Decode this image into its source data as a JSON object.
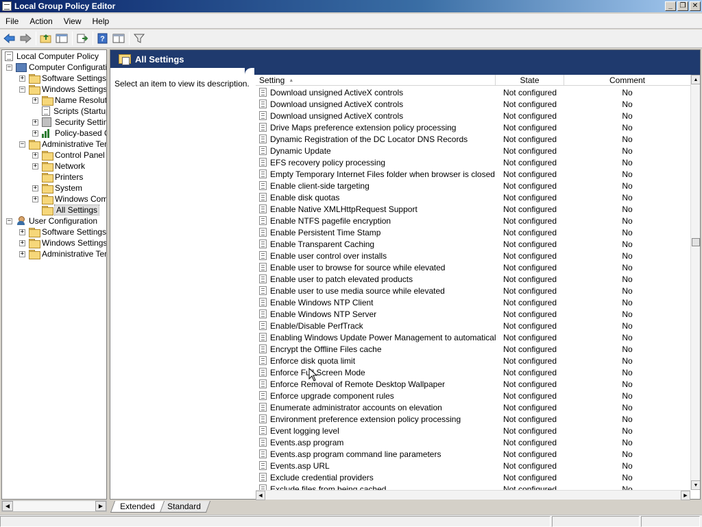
{
  "window": {
    "title": "Local Group Policy Editor",
    "minimize": "_",
    "maximize": "❐",
    "close": "✕"
  },
  "menu": [
    "File",
    "Action",
    "View",
    "Help"
  ],
  "toolbar": {
    "buttons": [
      "back-arrow-icon",
      "forward-arrow-icon",
      "up-folder-icon",
      "show-hide-tree-icon",
      "export-list-icon",
      "help-icon",
      "properties-icon",
      "filter-icon"
    ]
  },
  "tree": {
    "root": "Local Computer Policy",
    "computer_configuration": "Computer Configuration",
    "software_settings": "Software Settings",
    "windows_settings": "Windows Settings",
    "name_resolution": "Name Resolutio",
    "scripts": "Scripts (Startup",
    "security_settings": "Security Setting",
    "policy_based_qos": "Policy-based Q",
    "administrative_templates": "Administrative Temp",
    "control_panel": "Control Panel",
    "network": "Network",
    "printers": "Printers",
    "system": "System",
    "windows_components": "Windows Comp",
    "all_settings": "All Settings",
    "user_configuration": "User Configuration",
    "user_software_settings": "Software Settings",
    "user_windows_settings": "Windows Settings",
    "user_administrative_templates": "Administrative Temp"
  },
  "right": {
    "banner_title": "All Settings",
    "description": "Select an item to view its description."
  },
  "grid": {
    "columns": [
      "Setting",
      "State",
      "Comment"
    ],
    "rows": [
      [
        "Download unsigned ActiveX controls",
        "Not configured",
        "No"
      ],
      [
        "Download unsigned ActiveX controls",
        "Not configured",
        "No"
      ],
      [
        "Download unsigned ActiveX controls",
        "Not configured",
        "No"
      ],
      [
        "Drive Maps preference extension policy processing",
        "Not configured",
        "No"
      ],
      [
        "Dynamic Registration of the DC Locator DNS Records",
        "Not configured",
        "No"
      ],
      [
        "Dynamic Update",
        "Not configured",
        "No"
      ],
      [
        "EFS recovery policy processing",
        "Not configured",
        "No"
      ],
      [
        "Empty Temporary Internet Files folder when browser is closed",
        "Not configured",
        "No"
      ],
      [
        "Enable client-side targeting",
        "Not configured",
        "No"
      ],
      [
        "Enable disk quotas",
        "Not configured",
        "No"
      ],
      [
        "Enable Native XMLHttpRequest Support",
        "Not configured",
        "No"
      ],
      [
        "Enable NTFS pagefile encryption",
        "Not configured",
        "No"
      ],
      [
        "Enable Persistent Time Stamp",
        "Not configured",
        "No"
      ],
      [
        "Enable Transparent Caching",
        "Not configured",
        "No"
      ],
      [
        "Enable user control over installs",
        "Not configured",
        "No"
      ],
      [
        "Enable user to browse for source while elevated",
        "Not configured",
        "No"
      ],
      [
        "Enable user to patch elevated products",
        "Not configured",
        "No"
      ],
      [
        "Enable user to use media source while elevated",
        "Not configured",
        "No"
      ],
      [
        "Enable Windows NTP Client",
        "Not configured",
        "No"
      ],
      [
        "Enable Windows NTP Server",
        "Not configured",
        "No"
      ],
      [
        "Enable/Disable PerfTrack",
        "Not configured",
        "No"
      ],
      [
        "Enabling Windows Update Power Management to automatically wa...",
        "Not configured",
        "No"
      ],
      [
        "Encrypt the Offline Files cache",
        "Not configured",
        "No"
      ],
      [
        "Enforce disk quota limit",
        "Not configured",
        "No"
      ],
      [
        "Enforce Full Screen Mode",
        "Not configured",
        "No"
      ],
      [
        "Enforce Removal of Remote Desktop Wallpaper",
        "Not configured",
        "No"
      ],
      [
        "Enforce upgrade component rules",
        "Not configured",
        "No"
      ],
      [
        "Enumerate administrator accounts on elevation",
        "Not configured",
        "No"
      ],
      [
        "Environment preference extension policy processing",
        "Not configured",
        "No"
      ],
      [
        "Event logging level",
        "Not configured",
        "No"
      ],
      [
        "Events.asp program",
        "Not configured",
        "No"
      ],
      [
        "Events.asp program command line parameters",
        "Not configured",
        "No"
      ],
      [
        "Events.asp URL",
        "Not configured",
        "No"
      ],
      [
        "Exclude credential providers",
        "Not configured",
        "No"
      ],
      [
        "Exclude files from being cached",
        "Not configured",
        "No"
      ]
    ]
  },
  "tabs": [
    "Extended",
    "Standard"
  ],
  "colors": {
    "banner": "#1f3a6e",
    "title_gradient_start": "#0a246a"
  }
}
